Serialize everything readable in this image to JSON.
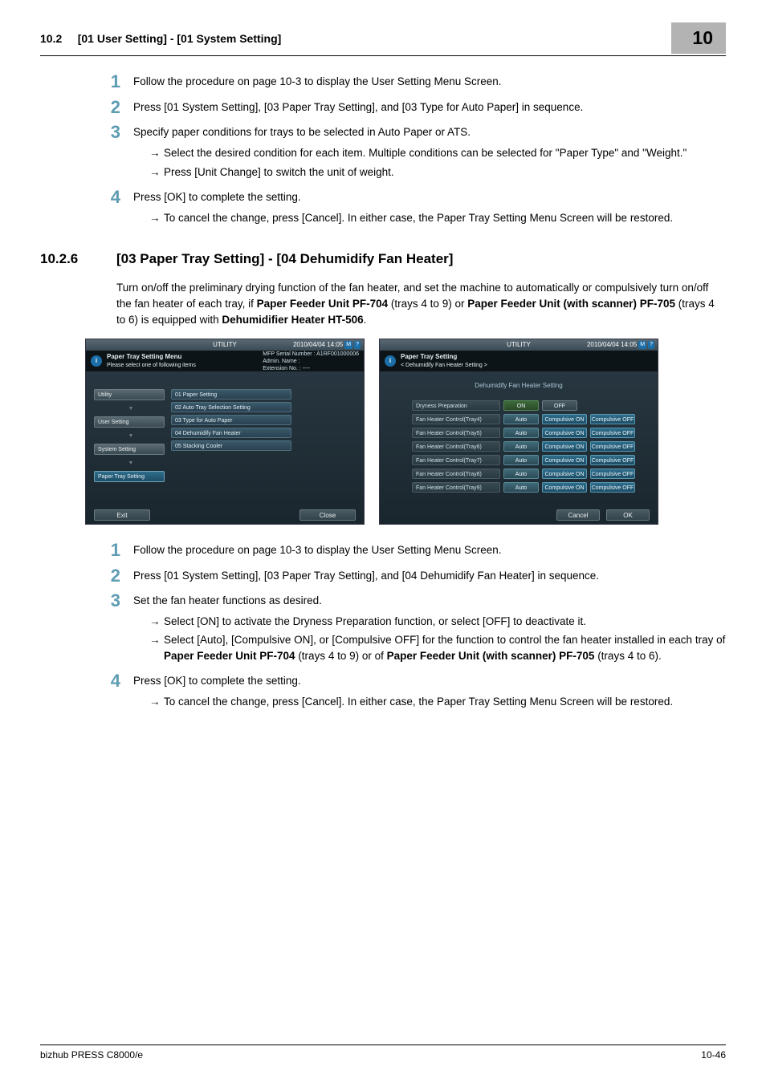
{
  "header": {
    "section_no": "10.2",
    "section_title": "[01 User Setting] - [01 System Setting]",
    "chapter": "10"
  },
  "block_a": {
    "s1": "Follow the procedure on page 10-3 to display the User Setting Menu Screen.",
    "s2": "Press [01 System Setting], [03 Paper Tray Setting], and [03 Type for Auto Paper] in sequence.",
    "s3": "Specify paper conditions for trays to be selected in Auto Paper or ATS.",
    "s3a": "Select the desired condition for each item. Multiple conditions can be selected for \"Paper Type\" and \"Weight.\"",
    "s3b": "Press [Unit Change] to switch the unit of weight.",
    "s4": "Press [OK] to complete the setting.",
    "s4a": "To cancel the change, press [Cancel]. In either case, the Paper Tray Setting Menu Screen will be restored."
  },
  "section": {
    "num": "10.2.6",
    "title": "[03 Paper Tray Setting] - [04 Dehumidify Fan Heater]",
    "intro_a": "Turn on/off the preliminary drying function of the fan heater, and set the machine to automatically or compulsively turn on/off the fan heater of each tray, if ",
    "intro_b": "Paper Feeder Unit PF-704",
    "intro_c": " (trays 4 to 9) or ",
    "intro_d": "Paper Feeder Unit (with scanner) PF-705",
    "intro_e": " (trays 4 to 6) is equipped with ",
    "intro_f": "Dehumidifier Heater HT-506",
    "intro_g": "."
  },
  "shot1": {
    "top": "UTILITY",
    "timestamp": "2010/04/04 14:05",
    "info_title": "Paper Tray Setting Menu",
    "info_sub": "Please select one of following items",
    "serial_lbl": "MFP Serial Number",
    "serial_val": "A1RF001000006",
    "admin": "Admin. Name :",
    "ext": "Extension No. : ----",
    "tabs": [
      "Utility",
      "User Setting",
      "System Setting",
      "Paper Tray Setting"
    ],
    "menu": [
      "01 Paper Setting",
      "02 Auto Tray Selection Setting",
      "03 Type for Auto Paper",
      "04 Dehumidify Fan Heater",
      "05 Stacking Cooler"
    ],
    "exit": "Exit",
    "close": "Close"
  },
  "shot2": {
    "top": "UTILITY",
    "timestamp": "2010/04/04 14:05",
    "info_title": "Paper Tray Setting",
    "info_sub": "< Dehumidify Fan Heater Setting >",
    "panel_title": "Dehumidify Fan Heater Setting",
    "rows": {
      "dry": "Dryness Preparation",
      "on": "ON",
      "off": "OFF",
      "tray4": "Fan Heater Control(Tray4)",
      "tray5": "Fan Heater Control(Tray5)",
      "tray6": "Fan Heater Control(Tray6)",
      "tray7": "Fan Heater Control(Tray7)",
      "tray8": "Fan Heater Control(Tray8)",
      "tray9": "Fan Heater Control(Tray9)",
      "auto": "Auto",
      "con": "Compulsive ON",
      "coff": "Compulsive OFF"
    },
    "cancel": "Cancel",
    "ok": "OK"
  },
  "block_b": {
    "s1": "Follow the procedure on page 10-3 to display the User Setting Menu Screen.",
    "s2": "Press [01 System Setting], [03 Paper Tray Setting], and [04 Dehumidify Fan Heater] in sequence.",
    "s3": "Set the fan heater functions as desired.",
    "s3a": "Select [ON] to activate the Dryness Preparation function, or select [OFF] to deactivate it.",
    "s3b_a": "Select [Auto], [Compulsive ON], or [Compulsive OFF] for the function to control the fan heater installed in each tray of ",
    "s3b_b": "Paper Feeder Unit PF-704",
    "s3b_c": " (trays 4 to 9) or of ",
    "s3b_d": "Paper Feeder Unit (with scanner) PF-705",
    "s3b_e": " (trays 4 to 6).",
    "s4": "Press [OK] to complete the setting.",
    "s4a": "To cancel the change, press [Cancel]. In either case, the Paper Tray Setting Menu Screen will be restored."
  },
  "footer": {
    "product": "bizhub PRESS C8000/e",
    "page": "10-46"
  }
}
